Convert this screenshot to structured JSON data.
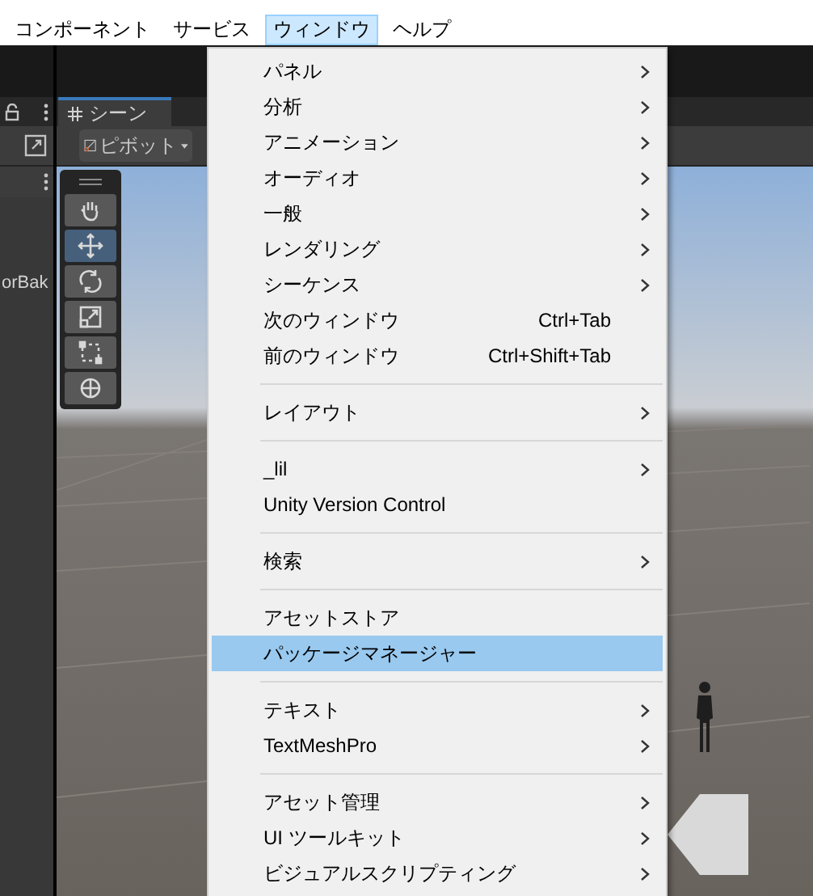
{
  "menu_bar": [
    {
      "label": "コンポーネント",
      "selected": false
    },
    {
      "label": "サービス",
      "selected": false
    },
    {
      "label": "ウィンドウ",
      "selected": true
    },
    {
      "label": "ヘルプ",
      "selected": false
    }
  ],
  "hierarchy": {
    "item": "orBak"
  },
  "scene": {
    "tab": "シーン",
    "pivot": "ピボット",
    "tools": [
      {
        "kind": "hand",
        "selected": false
      },
      {
        "kind": "move",
        "selected": true
      },
      {
        "kind": "rotate",
        "selected": false
      },
      {
        "kind": "scale",
        "selected": false
      },
      {
        "kind": "rect",
        "selected": false
      },
      {
        "kind": "transform",
        "selected": false
      }
    ]
  },
  "window_menu": {
    "items": [
      {
        "kind": "item",
        "label": "パネル",
        "submenu": true,
        "selected": false
      },
      {
        "kind": "item",
        "label": "分析",
        "submenu": true,
        "selected": false
      },
      {
        "kind": "item",
        "label": "アニメーション",
        "submenu": true,
        "selected": false
      },
      {
        "kind": "item",
        "label": "オーディオ",
        "submenu": true,
        "selected": false
      },
      {
        "kind": "item",
        "label": "一般",
        "submenu": true,
        "selected": false
      },
      {
        "kind": "item",
        "label": "レンダリング",
        "submenu": true,
        "selected": false
      },
      {
        "kind": "item",
        "label": "シーケンス",
        "submenu": true,
        "selected": false
      },
      {
        "kind": "item",
        "label": "次のウィンドウ",
        "shortcut": "Ctrl+Tab",
        "submenu": false,
        "selected": false
      },
      {
        "kind": "item",
        "label": "前のウィンドウ",
        "shortcut": "Ctrl+Shift+Tab",
        "submenu": false,
        "selected": false
      },
      {
        "kind": "separator"
      },
      {
        "kind": "item",
        "label": "レイアウト",
        "submenu": true,
        "selected": false
      },
      {
        "kind": "separator"
      },
      {
        "kind": "item",
        "label": "_lil",
        "submenu": true,
        "selected": false
      },
      {
        "kind": "item",
        "label": "Unity Version Control",
        "submenu": false,
        "selected": false
      },
      {
        "kind": "separator"
      },
      {
        "kind": "item",
        "label": "検索",
        "submenu": true,
        "selected": false
      },
      {
        "kind": "separator"
      },
      {
        "kind": "item",
        "label": "アセットストア",
        "submenu": false,
        "selected": false
      },
      {
        "kind": "item",
        "label": "パッケージマネージャー",
        "submenu": false,
        "selected": true
      },
      {
        "kind": "separator"
      },
      {
        "kind": "item",
        "label": "テキスト",
        "submenu": true,
        "selected": false
      },
      {
        "kind": "item",
        "label": "TextMeshPro",
        "submenu": true,
        "selected": false
      },
      {
        "kind": "separator"
      },
      {
        "kind": "item",
        "label": "アセット管理",
        "submenu": true,
        "selected": false
      },
      {
        "kind": "item",
        "label": "UI ツールキット",
        "submenu": true,
        "selected": false
      },
      {
        "kind": "item",
        "label": "ビジュアルスクリプティング",
        "submenu": true,
        "selected": false
      }
    ]
  }
}
